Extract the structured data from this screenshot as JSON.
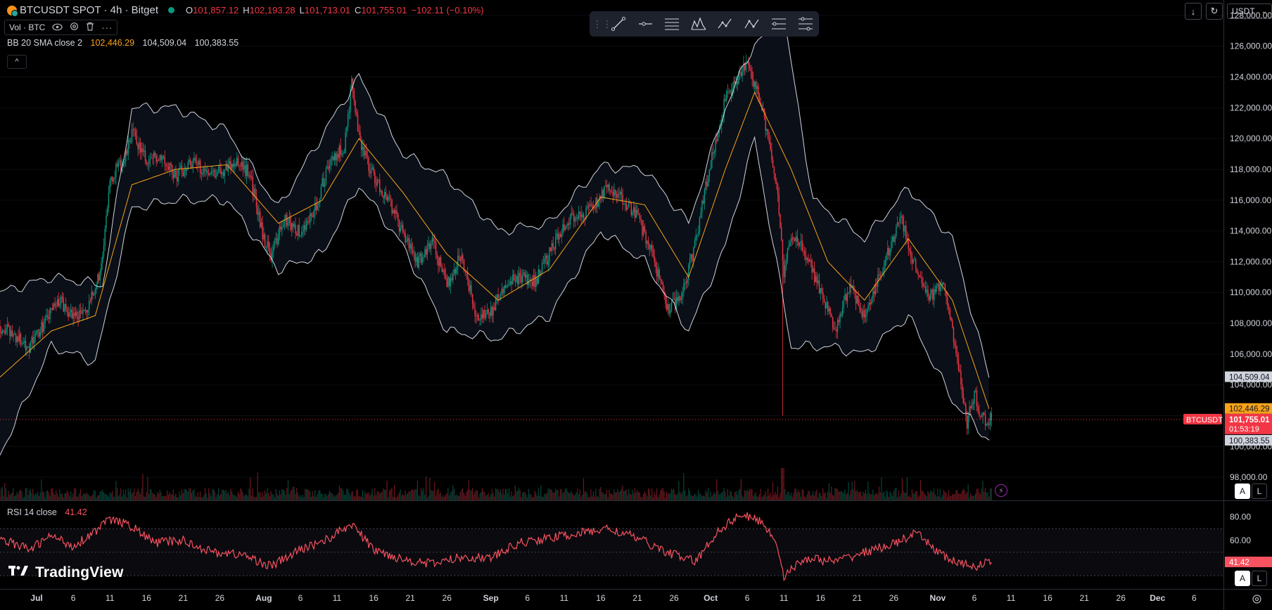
{
  "legend": {
    "symbol": "BTCUSDT SPOT",
    "interval": "4h",
    "exchange": "Bitget",
    "title": "BTCUSDT SPOT · 4h · Bitget",
    "open_key": "O",
    "open": "101,857.12",
    "high_key": "H",
    "high": "102,193.28",
    "low_key": "L",
    "low": "101,713.01",
    "close_key": "C",
    "close": "101,755.01",
    "change": "−102.11 (−0.10%)"
  },
  "volume_indicator": {
    "label": "Vol · BTC"
  },
  "bollinger": {
    "label": "BB 20 SMA close 2",
    "middle": "102,446.29",
    "upper": "104,509.04",
    "lower": "100,383.55"
  },
  "rsi": {
    "label": "RSI 14 close",
    "value": "41.42"
  },
  "currency": {
    "selected": "USDT"
  },
  "buttons": {
    "auto": "A",
    "log": "L"
  },
  "brand": {
    "name": "TradingView"
  },
  "colors": {
    "up": "#089981",
    "down": "#f23645",
    "bb_band": "#d1d4dc",
    "bb_basis": "#f7a21b",
    "rsi_line": "#f7525f",
    "background": "#000000",
    "bb_fill": "#0b0f17"
  },
  "icons": {
    "toolbar": [
      "trend-line-icon",
      "horizontal-ray-icon",
      "parallel-channel-icon",
      "pitchfork-icon",
      "abcd-pattern-icon",
      "abc-wave-icon",
      "fib-retracement-icon",
      "fib-extension-icon"
    ],
    "top_right": [
      "download-icon",
      "refresh-icon"
    ],
    "indicator_row": [
      "eye-icon",
      "settings-icon",
      "trash-icon",
      "more-icon"
    ]
  },
  "chart_data": [
    {
      "type": "candlestick",
      "title": "BTCUSDT SPOT · 4h · Bitget",
      "y_axis": {
        "ticks": [
          98000,
          100000,
          102000,
          104000,
          106000,
          108000,
          110000,
          112000,
          114000,
          116000,
          118000,
          120000,
          122000,
          124000,
          126000,
          128000
        ],
        "tick_labels": [
          "98,000.00",
          "100,000.00",
          "102,000.00",
          "104,000.00",
          "106,000.00",
          "108,000.00",
          "110,000.00",
          "112,000.00",
          "114,000.00",
          "116,000.00",
          "118,000.00",
          "120,000.00",
          "122,000.00",
          "124,000.00",
          "126,000.00",
          "128,000.00"
        ],
        "range": [
          96500,
          129000
        ],
        "scale": "linear",
        "side": "right"
      },
      "x_axis": {
        "range": [
          "2025-06-26",
          "2025-12-10"
        ],
        "ticks": [
          "2025-06-26",
          "2025-07-01",
          "2025-07-06",
          "2025-07-11",
          "2025-07-16",
          "2025-07-21",
          "2025-07-26",
          "2025-08-01",
          "2025-08-06",
          "2025-08-11",
          "2025-08-16",
          "2025-08-21",
          "2025-08-26",
          "2025-09-01",
          "2025-09-06",
          "2025-09-11",
          "2025-09-16",
          "2025-09-21",
          "2025-09-26",
          "2025-10-01",
          "2025-10-06",
          "2025-10-11",
          "2025-10-16",
          "2025-10-21",
          "2025-10-26",
          "2025-11-01",
          "2025-11-06",
          "2025-11-11",
          "2025-11-16",
          "2025-11-21",
          "2025-11-26",
          "2025-12-01",
          "2025-12-06"
        ],
        "tick_labels": [
          "26",
          "Jul",
          "6",
          "11",
          "16",
          "21",
          "26",
          "Aug",
          "6",
          "11",
          "16",
          "21",
          "26",
          "Sep",
          "6",
          "11",
          "16",
          "21",
          "26",
          "Oct",
          "6",
          "11",
          "16",
          "21",
          "26",
          "Nov",
          "6",
          "11",
          "16",
          "21",
          "26",
          "Dec",
          "6"
        ]
      },
      "series": [
        {
          "name": "BTCUSDT",
          "kind": "price (approx. daily closes)",
          "x": [
            "2025-06-26",
            "2025-06-28",
            "2025-06-30",
            "2025-07-02",
            "2025-07-04",
            "2025-07-06",
            "2025-07-08",
            "2025-07-10",
            "2025-07-11",
            "2025-07-13",
            "2025-07-14",
            "2025-07-16",
            "2025-07-18",
            "2025-07-20",
            "2025-07-22",
            "2025-07-24",
            "2025-07-26",
            "2025-07-28",
            "2025-07-30",
            "2025-08-01",
            "2025-08-02",
            "2025-08-04",
            "2025-08-06",
            "2025-08-08",
            "2025-08-10",
            "2025-08-12",
            "2025-08-13",
            "2025-08-14",
            "2025-08-16",
            "2025-08-18",
            "2025-08-20",
            "2025-08-22",
            "2025-08-24",
            "2025-08-26",
            "2025-08-28",
            "2025-08-30",
            "2025-09-01",
            "2025-09-03",
            "2025-09-05",
            "2025-09-07",
            "2025-09-09",
            "2025-09-11",
            "2025-09-13",
            "2025-09-15",
            "2025-09-17",
            "2025-09-19",
            "2025-09-21",
            "2025-09-23",
            "2025-09-25",
            "2025-09-27",
            "2025-09-29",
            "2025-10-01",
            "2025-10-03",
            "2025-10-05",
            "2025-10-06",
            "2025-10-08",
            "2025-10-10",
            "2025-10-11",
            "2025-10-12",
            "2025-10-14",
            "2025-10-16",
            "2025-10-18",
            "2025-10-20",
            "2025-10-22",
            "2025-10-24",
            "2025-10-26",
            "2025-10-27",
            "2025-10-29",
            "2025-10-31",
            "2025-11-02",
            "2025-11-04",
            "2025-11-05",
            "2025-11-06",
            "2025-11-07",
            "2025-11-08"
          ],
          "close": [
            107800,
            107200,
            106500,
            108000,
            109500,
            108500,
            108800,
            112000,
            117500,
            118500,
            120500,
            118500,
            119000,
            117500,
            118500,
            118000,
            117800,
            118500,
            117800,
            113500,
            112500,
            114800,
            113800,
            115500,
            118500,
            119500,
            123500,
            120000,
            117500,
            116000,
            113800,
            112000,
            113300,
            110500,
            112500,
            108500,
            108800,
            110500,
            111000,
            110700,
            112500,
            114500,
            115000,
            115500,
            116800,
            116000,
            115000,
            112500,
            109000,
            109500,
            113500,
            118500,
            122500,
            124000,
            125000,
            122000,
            117000,
            111000,
            114000,
            112500,
            110000,
            107500,
            110500,
            108500,
            111000,
            113500,
            114800,
            111500,
            109800,
            110500,
            104500,
            101500,
            103500,
            101800,
            101755
          ]
        },
        {
          "name": "BB basis (SMA 20)",
          "x": [
            "2025-06-26",
            "2025-07-03",
            "2025-07-09",
            "2025-07-14",
            "2025-07-20",
            "2025-07-27",
            "2025-08-03",
            "2025-08-09",
            "2025-08-14",
            "2025-08-20",
            "2025-08-26",
            "2025-09-02",
            "2025-09-09",
            "2025-09-16",
            "2025-09-22",
            "2025-09-28",
            "2025-10-03",
            "2025-10-07",
            "2025-10-12",
            "2025-10-17",
            "2025-10-22",
            "2025-10-28",
            "2025-11-03",
            "2025-11-08"
          ],
          "values": [
            104500,
            107500,
            108500,
            117000,
            118000,
            118300,
            114500,
            116000,
            120000,
            116500,
            112500,
            109500,
            111500,
            116200,
            115700,
            111000,
            118000,
            123000,
            118000,
            112000,
            109500,
            113500,
            109500,
            102446
          ]
        },
        {
          "name": "BB upper",
          "x": [
            "2025-06-26",
            "2025-07-03",
            "2025-07-10",
            "2025-07-14",
            "2025-07-20",
            "2025-07-27",
            "2025-08-03",
            "2025-08-10",
            "2025-08-14",
            "2025-08-20",
            "2025-08-26",
            "2025-09-02",
            "2025-09-09",
            "2025-09-16",
            "2025-09-22",
            "2025-09-28",
            "2025-10-03",
            "2025-10-07",
            "2025-10-11",
            "2025-10-15",
            "2025-10-22",
            "2025-10-28",
            "2025-11-03",
            "2025-11-08"
          ],
          "values": [
            110000,
            111000,
            110500,
            122000,
            122000,
            120500,
            115500,
            121000,
            124000,
            119000,
            117500,
            114000,
            114500,
            118200,
            118000,
            114500,
            122000,
            126200,
            127800,
            116000,
            113500,
            116800,
            113500,
            104509
          ]
        },
        {
          "name": "BB lower",
          "x": [
            "2025-06-26",
            "2025-07-03",
            "2025-07-09",
            "2025-07-14",
            "2025-07-20",
            "2025-07-27",
            "2025-08-03",
            "2025-08-09",
            "2025-08-14",
            "2025-08-20",
            "2025-08-26",
            "2025-09-02",
            "2025-09-09",
            "2025-09-16",
            "2025-09-22",
            "2025-09-28",
            "2025-10-03",
            "2025-10-07",
            "2025-10-12",
            "2025-10-17",
            "2025-10-22",
            "2025-10-28",
            "2025-11-03",
            "2025-11-08"
          ],
          "values": [
            99500,
            106500,
            105500,
            115500,
            116000,
            116000,
            111500,
            112500,
            117000,
            113000,
            107500,
            107000,
            108500,
            114000,
            112000,
            107500,
            113000,
            120000,
            106500,
            106500,
            106000,
            108500,
            103000,
            100384
          ]
        }
      ],
      "annotations": [
        {
          "text": "104,509.04",
          "value": 104509.04,
          "color": "#d1d4dc"
        },
        {
          "text": "102,446.29",
          "value": 102446.29,
          "color": "#f7a21b"
        },
        {
          "text": "BTCUSDT",
          "value": 101755.01,
          "color": "#f23645"
        },
        {
          "text": "101,755.01",
          "value": 101755.01,
          "color": "#f23645"
        },
        {
          "text": "01:53:19",
          "value": 101755.01,
          "color": "#f23645"
        },
        {
          "text": "100,383.55",
          "value": 100383.55,
          "color": "#d1d4dc"
        }
      ]
    },
    {
      "type": "line",
      "title": "RSI 14 close",
      "y_axis": {
        "ticks": [
          60,
          80
        ],
        "tick_labels": [
          "60.00",
          "80.00"
        ],
        "range": [
          20,
          88
        ]
      },
      "series": [
        {
          "name": "RSI",
          "x": [
            "2025-06-26",
            "2025-06-30",
            "2025-07-03",
            "2025-07-06",
            "2025-07-09",
            "2025-07-11",
            "2025-07-14",
            "2025-07-17",
            "2025-07-21",
            "2025-07-25",
            "2025-07-29",
            "2025-08-02",
            "2025-08-06",
            "2025-08-10",
            "2025-08-13",
            "2025-08-16",
            "2025-08-20",
            "2025-08-24",
            "2025-08-28",
            "2025-09-01",
            "2025-09-05",
            "2025-09-09",
            "2025-09-13",
            "2025-09-17",
            "2025-09-21",
            "2025-09-25",
            "2025-09-29",
            "2025-10-02",
            "2025-10-05",
            "2025-10-08",
            "2025-10-10",
            "2025-10-11",
            "2025-10-14",
            "2025-10-18",
            "2025-10-22",
            "2025-10-26",
            "2025-10-29",
            "2025-11-02",
            "2025-11-04",
            "2025-11-06",
            "2025-11-08"
          ],
          "values": [
            62,
            52,
            64,
            55,
            68,
            78,
            72,
            58,
            60,
            50,
            48,
            38,
            52,
            62,
            74,
            52,
            44,
            40,
            46,
            45,
            58,
            62,
            66,
            70,
            62,
            50,
            42,
            68,
            82,
            76,
            58,
            30,
            45,
            42,
            50,
            57,
            66,
            46,
            40,
            38,
            41.42
          ]
        }
      ],
      "annotations": [
        {
          "text": "41.42",
          "value": 41.42,
          "color": "#f7525f"
        }
      ]
    }
  ]
}
